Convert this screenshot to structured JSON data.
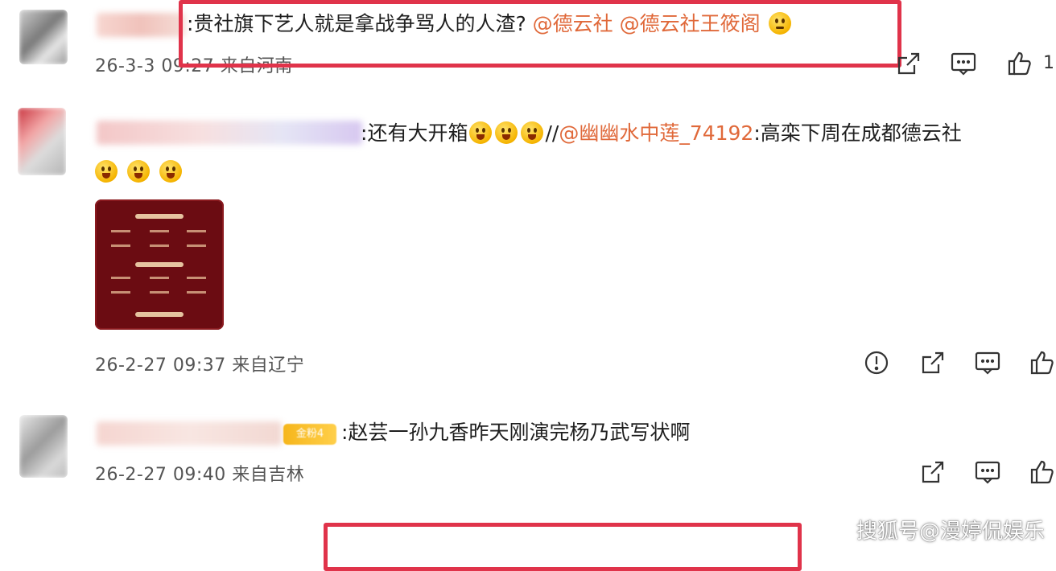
{
  "comments": [
    {
      "text_prefix": ":",
      "text": "贵社旗下艺人就是拿战争骂人的人渣?",
      "mentions": [
        "@德云社",
        "@德云社王筱阁"
      ],
      "emoji_end": "smirk-emoji",
      "timestamp": "26-3-3 09:27",
      "location": "来自河南"
    },
    {
      "text_prefix": ":",
      "text": "还有大开箱",
      "repost_sep": "//",
      "repost_mention": "@幽幽水中莲_74192",
      "repost_text": ":高栾下周在成都德云社",
      "timestamp": "26-2-27 09:37",
      "location": "来自辽宁"
    },
    {
      "text_prefix": ":",
      "text": "赵芸一孙九香昨天刚演完杨乃武写状啊",
      "badge": "金粉4",
      "timestamp": "26-2-27 09:40",
      "location": "来自吉林"
    }
  ],
  "partial_like_count": "1",
  "watermark": "搜狐号@漫婷侃娱乐",
  "colors": {
    "highlight_box": "#e0334a",
    "mention": "#e0693a",
    "meta_text": "#555555",
    "thumbnail_bg": "#6b0c12"
  }
}
